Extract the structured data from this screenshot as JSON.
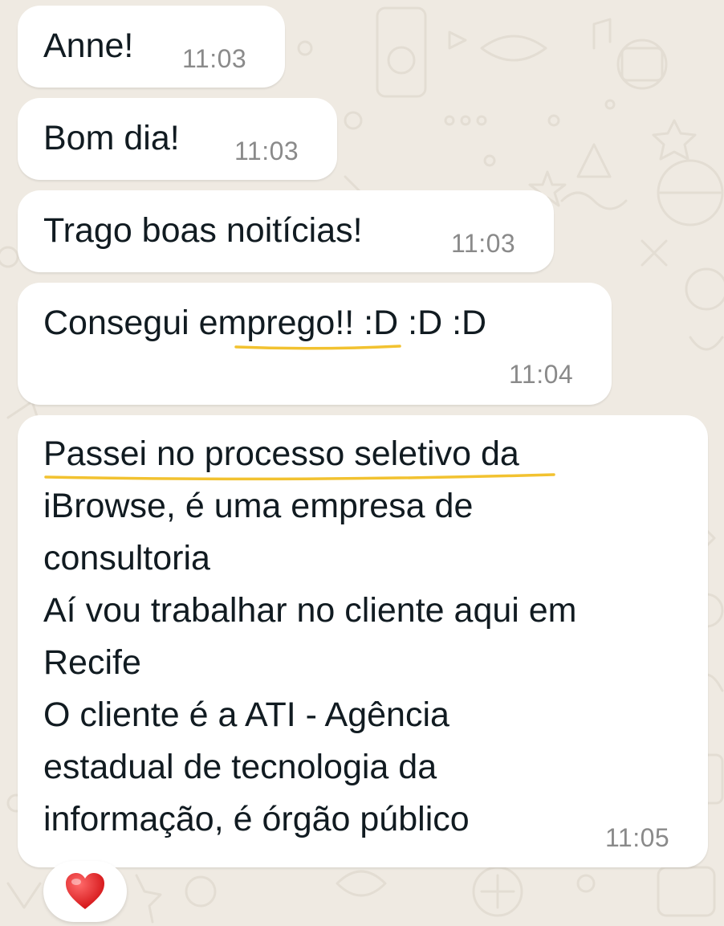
{
  "messages": [
    {
      "text": "Anne!",
      "time": "11:03"
    },
    {
      "text": "Bom dia!",
      "time": "11:03"
    },
    {
      "text": "Trago boas noitícias!",
      "time": "11:03"
    },
    {
      "text": "Consegui emprego!! :D :D :D",
      "time": "11:04"
    },
    {
      "lines": [
        "Passei no processo seletivo da",
        "iBrowse, é uma empresa de",
        "consultoria",
        "Aí vou trabalhar no cliente aqui em",
        "Recife",
        "O cliente é a ATI - Agência",
        "estadual de tecnologia da",
        "informação, é órgão público"
      ],
      "time": "11:05"
    }
  ],
  "reaction": {
    "icon": "heart-icon",
    "color": "#e0191b"
  },
  "colors": {
    "wallpaper": "#efeae2",
    "bubble": "#ffffff",
    "text": "#111b21",
    "timestamp": "#8a8a8a",
    "spellcheck_underline": "#f2c230"
  }
}
